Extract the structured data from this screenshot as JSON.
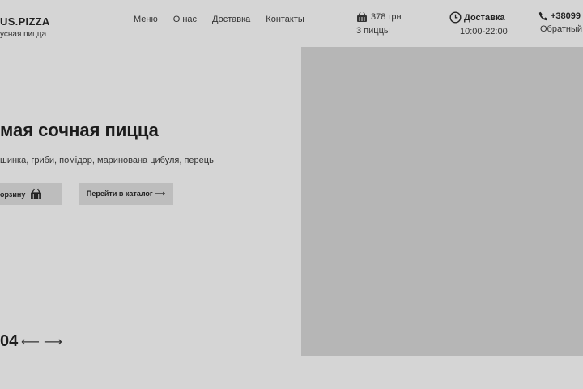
{
  "header": {
    "logo_name": "US.PIZZA",
    "logo_tagline": "усная пицца",
    "nav": [
      "Меню",
      "О нас",
      "Доставка",
      "Контакты"
    ],
    "cart": {
      "total": "378 грн",
      "count": "3 пиццы",
      "icon": "basket-icon"
    },
    "delivery": {
      "label": "Доставка",
      "hours": "10:00-22:00",
      "icon": "clock-icon"
    },
    "contact": {
      "phone": "+38099",
      "callback_label": "Обратный",
      "icon": "phone-icon"
    }
  },
  "hero": {
    "title": "мая сочная пицца",
    "ingredients": "шинка, гриби, помідор, маринована цибуля, перець",
    "cart_button": "орзину",
    "catalog_button": "Перейти в каталог ⟶",
    "slide_number": "04",
    "prev_arrow": "⟵",
    "next_arrow": "⟶"
  },
  "colors": {
    "background": "#d5d5d5",
    "image_placeholder": "#b6b6b6",
    "button": "#bdbdbd"
  }
}
